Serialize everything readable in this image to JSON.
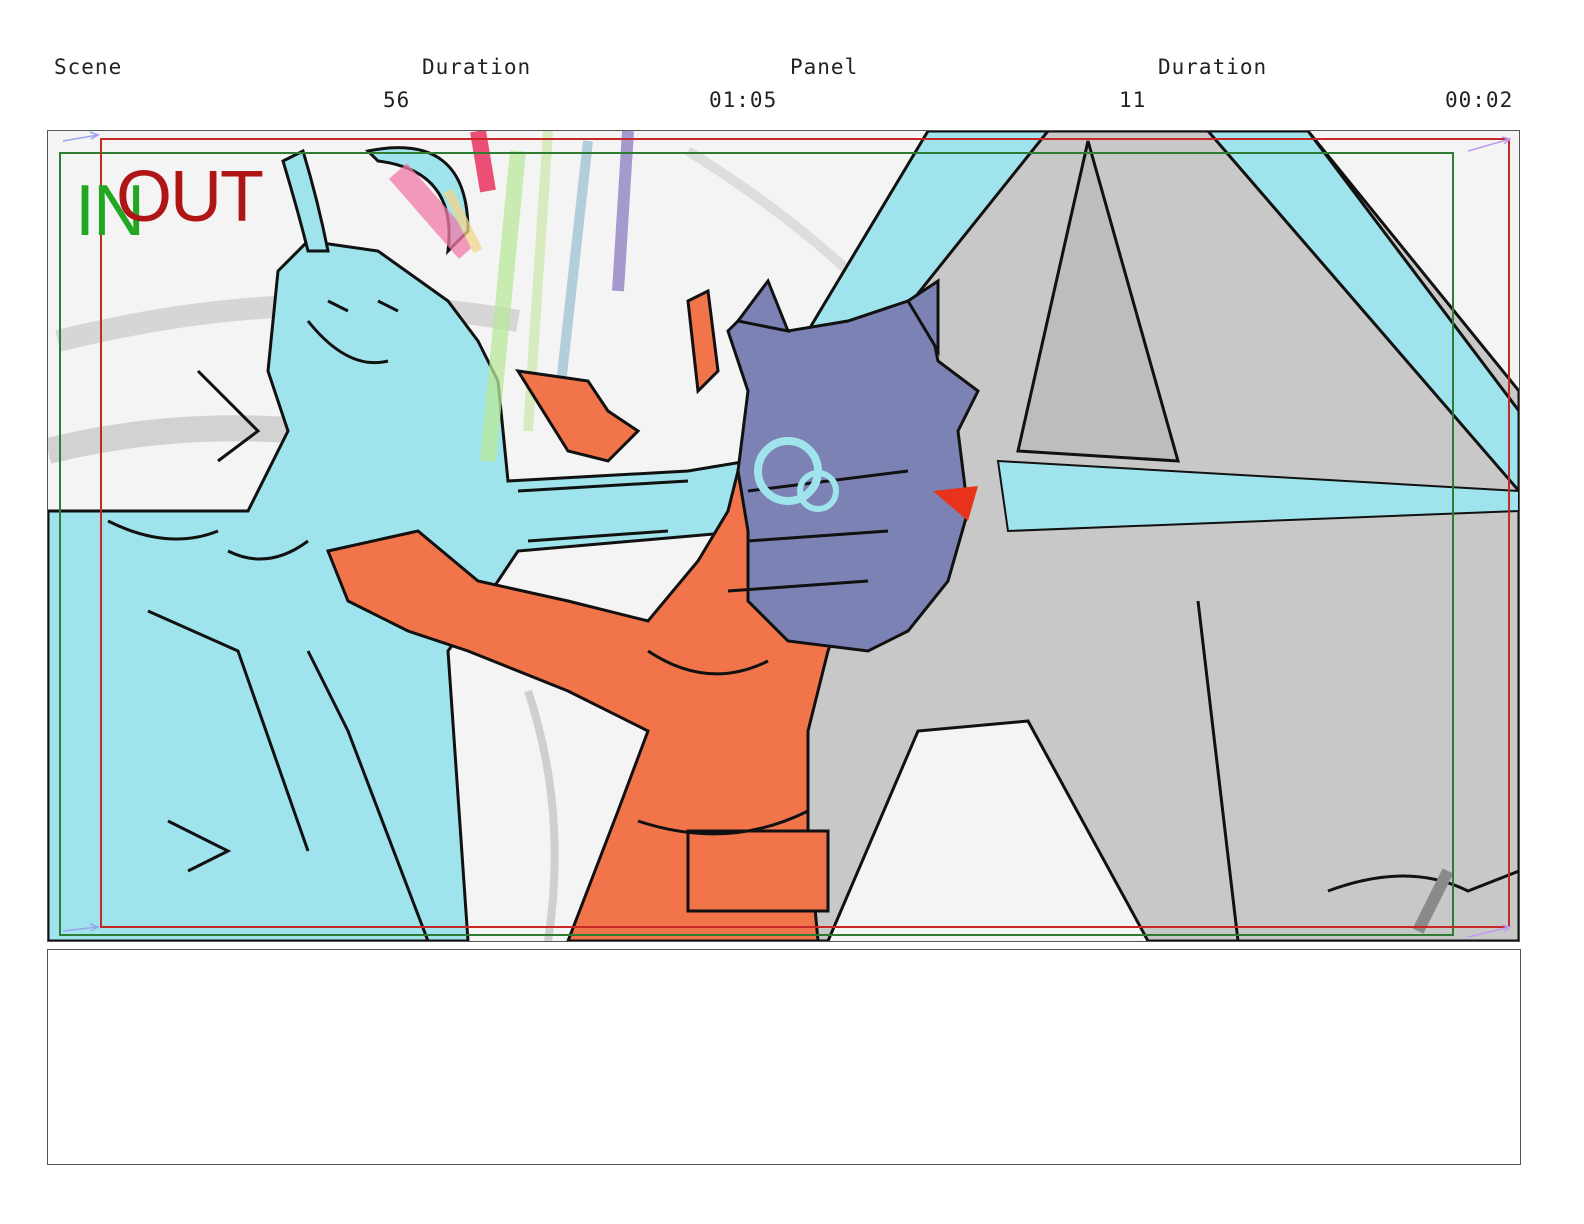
{
  "header": {
    "scene_label": "Scene",
    "scene_duration_label": "Duration",
    "panel_label": "Panel",
    "panel_duration_label": "Duration",
    "scene_value": "56",
    "scene_duration_value": "01:05",
    "panel_value": "11",
    "panel_duration_value": "00:02"
  },
  "panel": {
    "in_tag": "IN",
    "out_tag": "OUT",
    "in_color": "#22a722",
    "out_color": "#b01515",
    "safe_frame_color": "#2e7d32",
    "action_frame_color": "#c62828"
  },
  "palette": {
    "cyan_character": "#9fe4ec",
    "orange_character": "#f2744a",
    "purple_creature": "#7d82b4",
    "grey_structure": "#c8c8c8",
    "ink": "#111111"
  },
  "notes": {
    "text": ""
  }
}
